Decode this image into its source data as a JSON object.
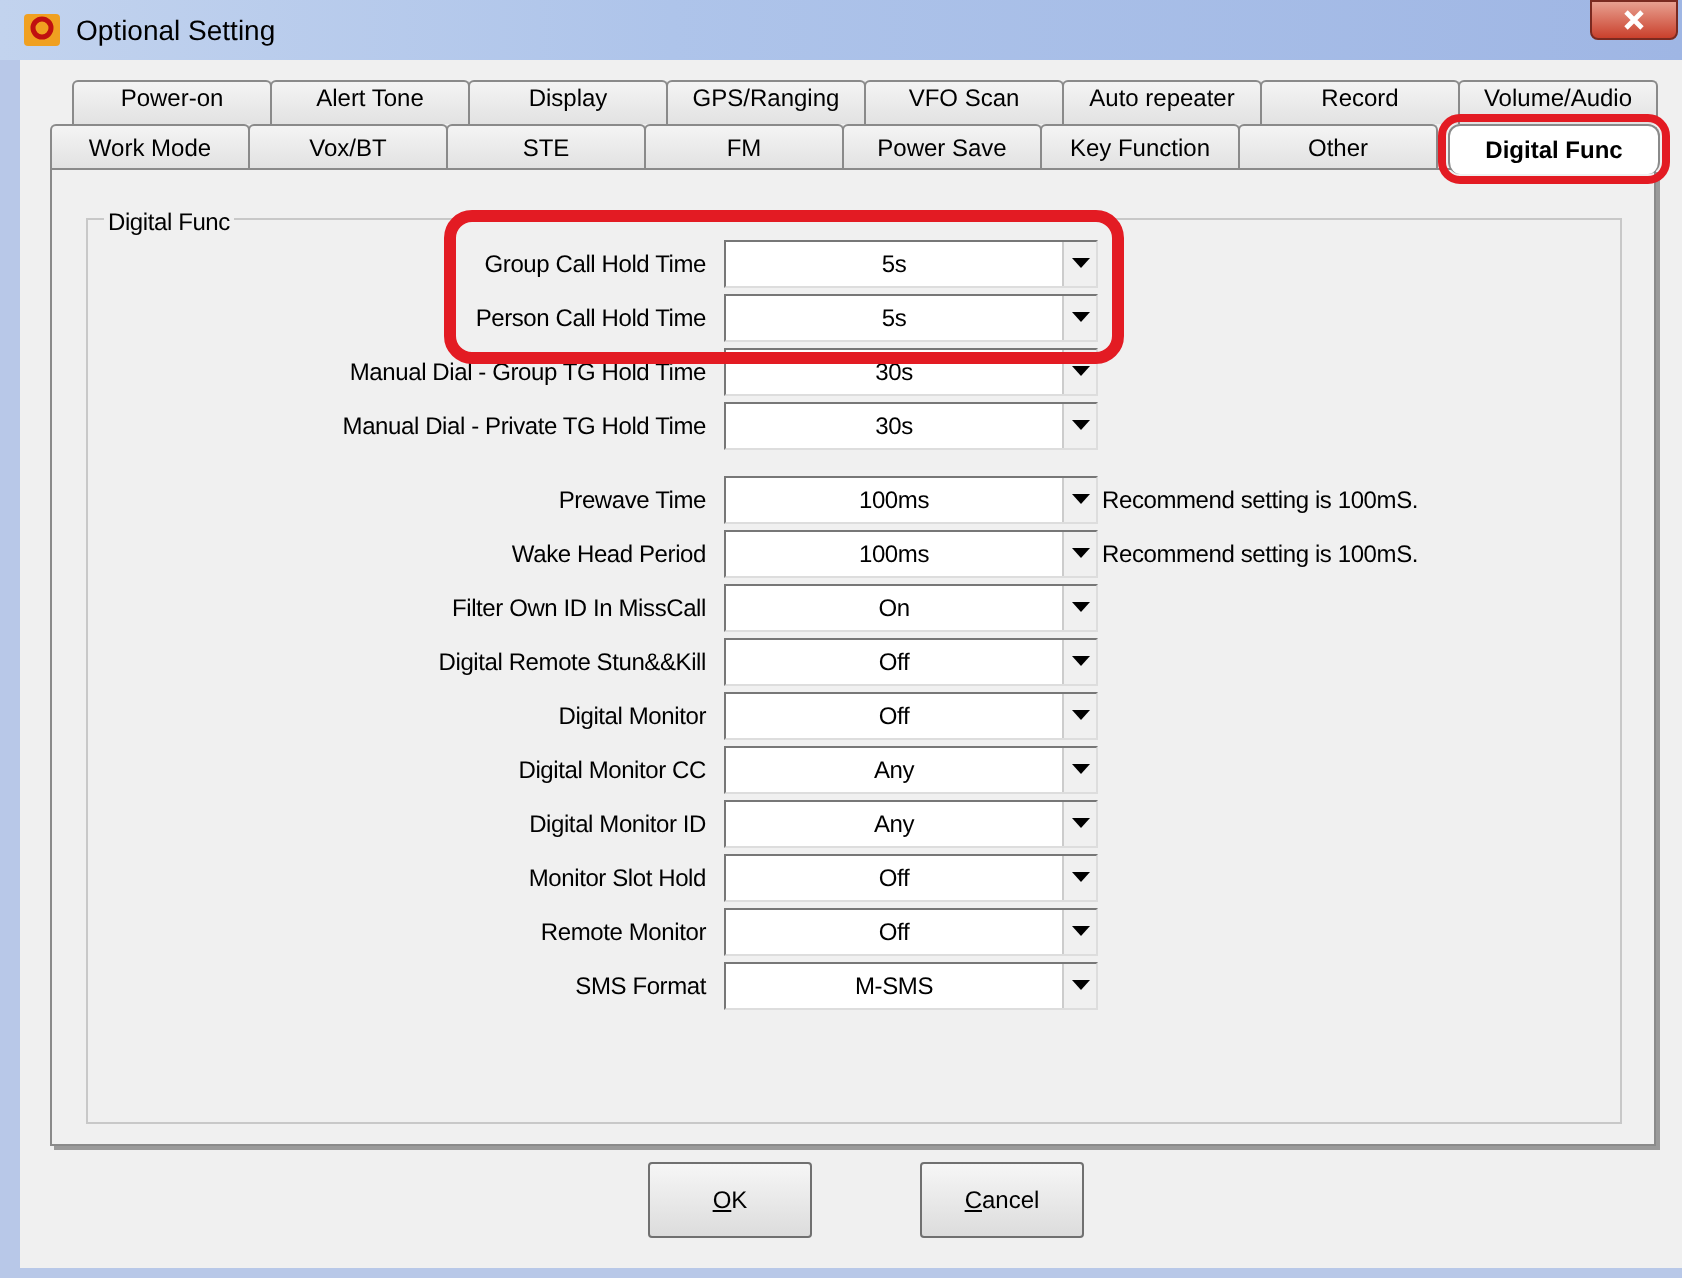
{
  "window": {
    "title": "Optional Setting"
  },
  "tab_rows": [
    [
      {
        "label": "Power-on",
        "selected": false,
        "highlighted": false
      },
      {
        "label": "Alert Tone",
        "selected": false,
        "highlighted": false
      },
      {
        "label": "Display",
        "selected": false,
        "highlighted": false
      },
      {
        "label": "GPS/Ranging",
        "selected": false,
        "highlighted": false
      },
      {
        "label": "VFO Scan",
        "selected": false,
        "highlighted": false
      },
      {
        "label": "Auto repeater",
        "selected": false,
        "highlighted": false
      },
      {
        "label": "Record",
        "selected": false,
        "highlighted": false
      },
      {
        "label": "Volume/Audio",
        "selected": false,
        "highlighted": false
      }
    ],
    [
      {
        "label": "Work Mode",
        "selected": false,
        "highlighted": false
      },
      {
        "label": "Vox/BT",
        "selected": false,
        "highlighted": false
      },
      {
        "label": "STE",
        "selected": false,
        "highlighted": false
      },
      {
        "label": "FM",
        "selected": false,
        "highlighted": false
      },
      {
        "label": "Power Save",
        "selected": false,
        "highlighted": false
      },
      {
        "label": "Key Function",
        "selected": false,
        "highlighted": false
      },
      {
        "label": "Other",
        "selected": false,
        "highlighted": false
      },
      {
        "label": "Digital Func",
        "selected": true,
        "highlighted": true
      }
    ]
  ],
  "group": {
    "title": "Digital Func",
    "field_groups": [
      [
        {
          "label": "Group Call Hold Time",
          "value": "5s",
          "highlighted": true
        },
        {
          "label": "Person Call Hold Time",
          "value": "5s",
          "highlighted": true
        },
        {
          "label": "Manual Dial - Group TG Hold Time",
          "value": "30s",
          "highlighted": false
        },
        {
          "label": "Manual Dial - Private TG Hold Time",
          "value": "30s",
          "highlighted": false
        }
      ],
      [
        {
          "label": "Prewave Time",
          "value": "100ms",
          "note": "Recommend setting is 100mS.",
          "highlighted": false
        },
        {
          "label": "Wake Head Period",
          "value": "100ms",
          "note": "Recommend setting is 100mS.",
          "highlighted": false
        },
        {
          "label": "Filter Own ID In MissCall",
          "value": "On",
          "highlighted": false
        },
        {
          "label": "Digital Remote Stun&&Kill",
          "value": "Off",
          "highlighted": false
        },
        {
          "label": "Digital Monitor",
          "value": "Off",
          "highlighted": false
        },
        {
          "label": "Digital Monitor CC",
          "value": "Any",
          "highlighted": false
        },
        {
          "label": "Digital Monitor ID",
          "value": "Any",
          "highlighted": false
        },
        {
          "label": "Monitor Slot Hold",
          "value": "Off",
          "highlighted": false
        },
        {
          "label": "Remote Monitor",
          "value": "Off",
          "highlighted": false
        },
        {
          "label": "SMS Format",
          "value": "M-SMS",
          "highlighted": false
        }
      ]
    ]
  },
  "buttons": [
    {
      "label": "OK",
      "first_letter_underlined": true
    },
    {
      "label": "Cancel",
      "first_letter_underlined": true
    }
  ]
}
